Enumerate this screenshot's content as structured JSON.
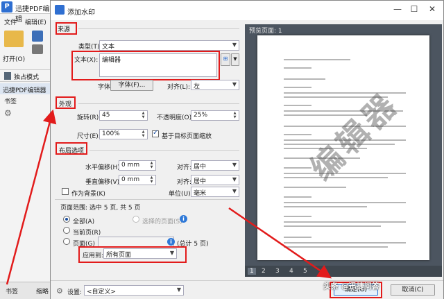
{
  "background_app": {
    "title": "迅捷PDF编辑",
    "logo": "P",
    "menu": [
      "文件",
      "编辑(E)"
    ],
    "open_label": "打开(O)",
    "mode_label": "独占模式",
    "doc_tab": "迅捷PDF编辑器",
    "bookmark_panel": "书签",
    "bottom_tabs": [
      "书签",
      "缩略"
    ]
  },
  "dialog": {
    "title": "添加水印",
    "controls": {
      "minimize": "—",
      "maximize": "☐",
      "close": "✕"
    },
    "source": {
      "group_label": "来源",
      "type_label": "类型(T):",
      "type_value": "文本",
      "text_label": "文本(X):",
      "text_value": "编辑器",
      "font_label": "字体(F):",
      "font_button": "字体(F)...",
      "align_label": "对齐(L):",
      "align_value": "左"
    },
    "appearance": {
      "group_label": "外观",
      "rotation_label": "旋转(R):",
      "rotation_value": "45",
      "opacity_label": "不透明度(O):",
      "opacity_value": "25%",
      "size_label": "尺寸(E):",
      "size_value": "100%",
      "scale_check_label": "基于目标页面缩放"
    },
    "layout": {
      "group_label": "布局选项",
      "hoffset_label": "水平偏移(H):",
      "hoffset_value": "0 mm",
      "halign_label": "对齐:",
      "halign_value": "居中",
      "voffset_label": "垂直偏移(V):",
      "voffset_value": "0 mm",
      "valign_label": "对齐:",
      "valign_value": "居中",
      "background_check_label": "作为背景(K)",
      "unit_label": "单位(U):",
      "unit_value": "毫米"
    },
    "page_range": {
      "label": "页面范围: 选中 5 页, 共 5 页",
      "all_label": "全部(A)",
      "selected_label": "选择的页面(S)",
      "current_label": "当前页(R)",
      "pages_label": "页面(G)",
      "total_label": "(总计 5 页)",
      "apply_label": "应用到:",
      "apply_value": "所有页面"
    },
    "preview": {
      "label": "预览页面: 1",
      "watermark_text": "编辑器",
      "pages": [
        "1",
        "2",
        "3",
        "4",
        "5"
      ],
      "current_page": "1"
    },
    "footer": {
      "settings_label": "设置:",
      "settings_value": "<自定义>",
      "ok_button": "确定(O)",
      "cancel_button": "取消(C)"
    }
  },
  "overlay_watermark": "头条 @迅捷问答",
  "colors": {
    "highlight": "#e21b1b",
    "accent": "#2f79d8"
  }
}
